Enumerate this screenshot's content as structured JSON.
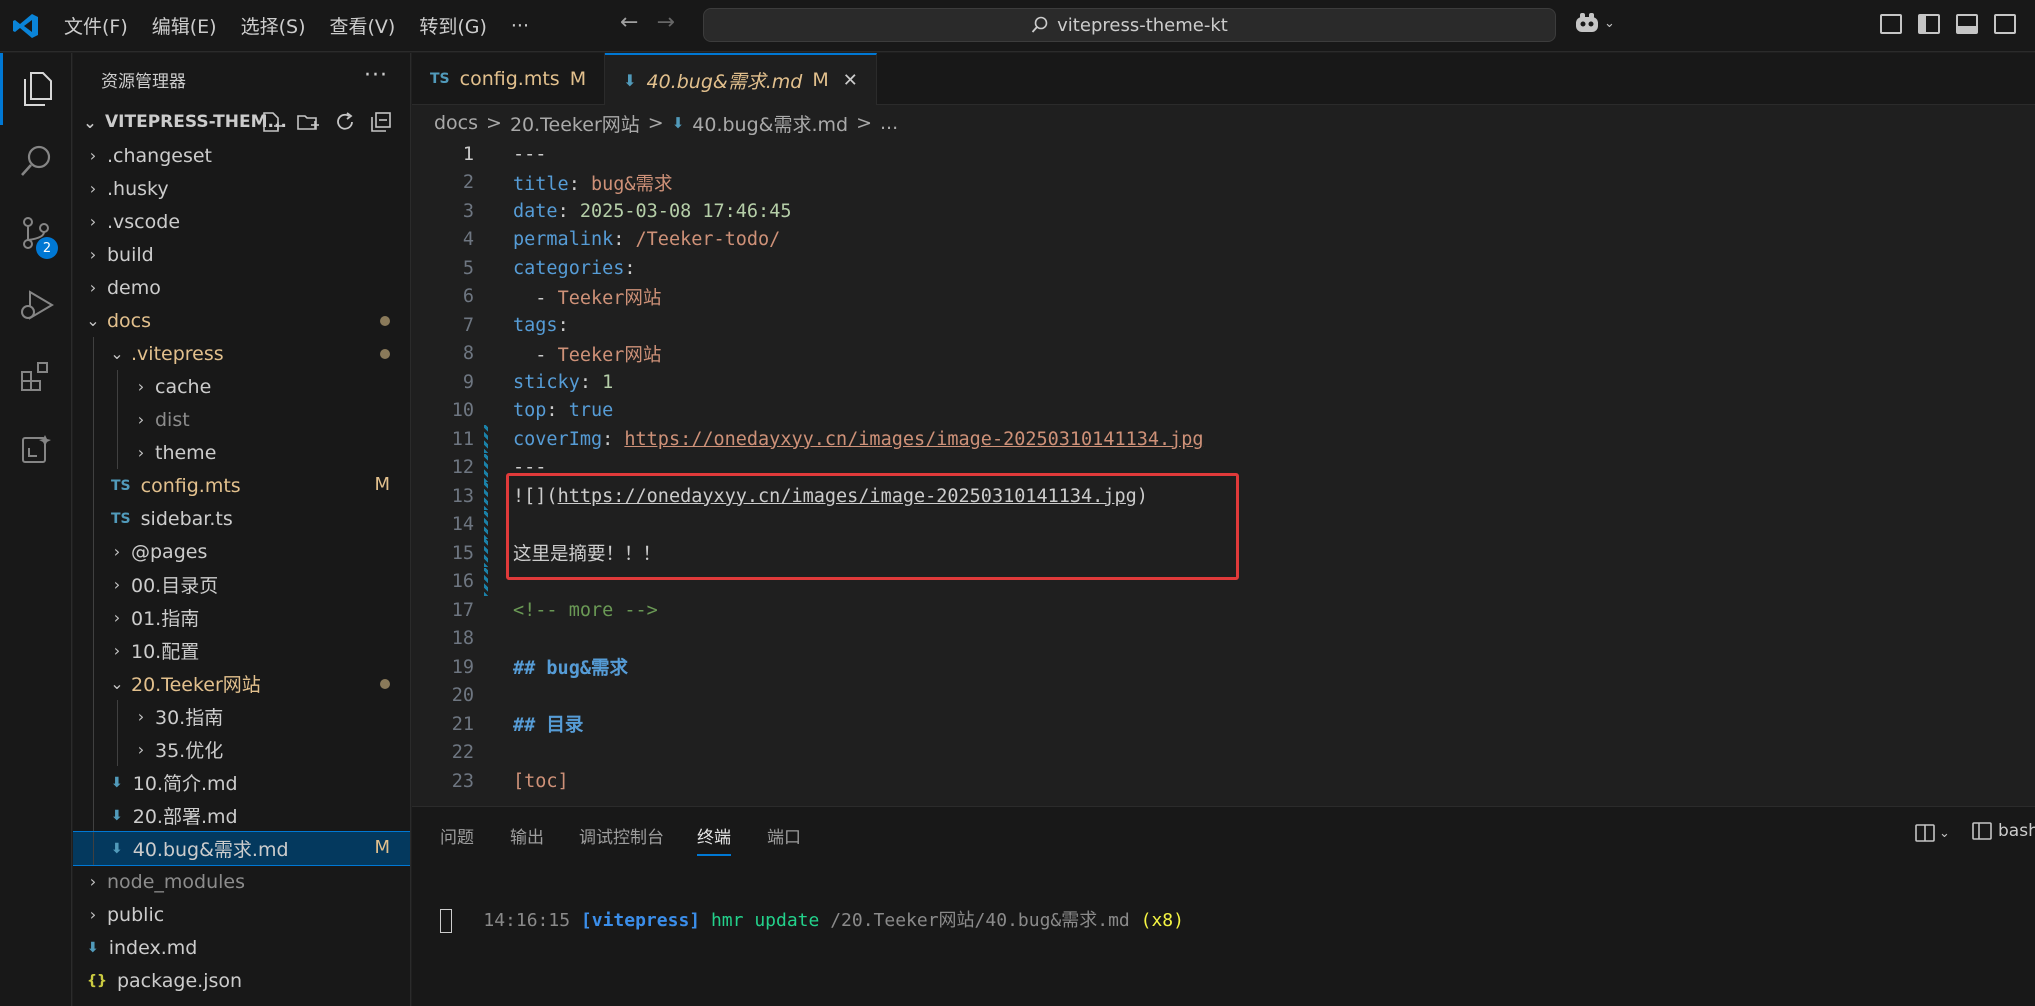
{
  "titlebar": {
    "menus": [
      "文件(F)",
      "编辑(E)",
      "选择(S)",
      "查看(V)",
      "转到(G)",
      "···"
    ],
    "search_text": "vitepress-theme-kt"
  },
  "activity": {
    "scm_badge": "2"
  },
  "sidebar": {
    "title": "资源管理器",
    "more": "···",
    "root": "VITEPRESS-THEM...",
    "items": [
      {
        "label": ".changeset",
        "indent": 0,
        "type": "folder",
        "open": false
      },
      {
        "label": ".husky",
        "indent": 0,
        "type": "folder",
        "open": false
      },
      {
        "label": ".vscode",
        "indent": 0,
        "type": "folder",
        "open": false
      },
      {
        "label": "build",
        "indent": 0,
        "type": "folder",
        "open": false
      },
      {
        "label": "demo",
        "indent": 0,
        "type": "folder",
        "open": false
      },
      {
        "label": "docs",
        "indent": 0,
        "type": "folder",
        "open": true,
        "dot": true,
        "color": "#e2c08d"
      },
      {
        "label": ".vitepress",
        "indent": 1,
        "type": "folder",
        "open": true,
        "dot": true,
        "color": "#e2c08d"
      },
      {
        "label": "cache",
        "indent": 2,
        "type": "folder",
        "open": false
      },
      {
        "label": "dist",
        "indent": 2,
        "type": "folder",
        "open": false,
        "color": "#8c8c8c"
      },
      {
        "label": "theme",
        "indent": 2,
        "type": "folder",
        "open": false
      },
      {
        "label": "config.mts",
        "indent": 1,
        "type": "ts",
        "mark": "M",
        "color": "#e2c08d"
      },
      {
        "label": "sidebar.ts",
        "indent": 1,
        "type": "ts"
      },
      {
        "label": "@pages",
        "indent": 1,
        "type": "folder",
        "open": false
      },
      {
        "label": "00.目录页",
        "indent": 1,
        "type": "folder",
        "open": false
      },
      {
        "label": "01.指南",
        "indent": 1,
        "type": "folder",
        "open": false
      },
      {
        "label": "10.配置",
        "indent": 1,
        "type": "folder",
        "open": false
      },
      {
        "label": "20.Teeker网站",
        "indent": 1,
        "type": "folder",
        "open": true,
        "dot": true,
        "color": "#e2c08d"
      },
      {
        "label": "30.指南",
        "indent": 2,
        "type": "folder",
        "open": false
      },
      {
        "label": "35.优化",
        "indent": 2,
        "type": "folder",
        "open": false
      },
      {
        "label": "10.简介.md",
        "indent": 1,
        "type": "md"
      },
      {
        "label": "20.部署.md",
        "indent": 1,
        "type": "md"
      },
      {
        "label": "40.bug&需求.md",
        "indent": 1,
        "type": "md",
        "mark": "M",
        "selected": true
      },
      {
        "label": "node_modules",
        "indent": 0,
        "type": "folder",
        "open": false,
        "color": "#8c8c8c"
      },
      {
        "label": "public",
        "indent": 0,
        "type": "folder",
        "open": false
      },
      {
        "label": "index.md",
        "indent": 0,
        "type": "md"
      },
      {
        "label": "package.json",
        "indent": 0,
        "type": "json"
      }
    ]
  },
  "tabs": [
    {
      "prefix": "TS",
      "label": "config.mts",
      "mark": "M",
      "active": false
    },
    {
      "prefix": "md",
      "label": "40.bug&需求.md",
      "mark": "M",
      "active": true,
      "close": "✕"
    }
  ],
  "breadcrumb": [
    "docs",
    ">",
    "20.Teeker网站",
    ">",
    "40.bug&需求.md",
    ">",
    "..."
  ],
  "editor": {
    "lines": [
      {
        "n": "1",
        "cur": true,
        "parts": [
          [
            "p",
            "---"
          ]
        ]
      },
      {
        "n": "2",
        "parts": [
          [
            "k",
            "title"
          ],
          [
            "p",
            ": "
          ],
          [
            "s",
            "bug&需求"
          ]
        ]
      },
      {
        "n": "3",
        "parts": [
          [
            "k",
            "date"
          ],
          [
            "p",
            ": "
          ],
          [
            "n",
            "2025-03-08 17:46:45"
          ]
        ]
      },
      {
        "n": "4",
        "parts": [
          [
            "k",
            "permalink"
          ],
          [
            "p",
            ": "
          ],
          [
            "s",
            "/Teeker-todo/"
          ]
        ]
      },
      {
        "n": "5",
        "parts": [
          [
            "k",
            "categories"
          ],
          [
            "p",
            ":"
          ]
        ]
      },
      {
        "n": "6",
        "parts": [
          [
            "p",
            "  - "
          ],
          [
            "s",
            "Teeker网站"
          ]
        ]
      },
      {
        "n": "7",
        "parts": [
          [
            "k",
            "tags"
          ],
          [
            "p",
            ":"
          ]
        ]
      },
      {
        "n": "8",
        "parts": [
          [
            "p",
            "  - "
          ],
          [
            "s",
            "Teeker网站"
          ]
        ]
      },
      {
        "n": "9",
        "parts": [
          [
            "k",
            "sticky"
          ],
          [
            "p",
            ": "
          ],
          [
            "n",
            "1"
          ]
        ]
      },
      {
        "n": "10",
        "parts": [
          [
            "k",
            "top"
          ],
          [
            "p",
            ": "
          ],
          [
            "k",
            "true"
          ]
        ]
      },
      {
        "n": "11",
        "mod": true,
        "parts": [
          [
            "k",
            "coverImg"
          ],
          [
            "p",
            ": "
          ],
          [
            "us",
            "https://onedayxyy.cn/images/image-20250310141134.jpg"
          ]
        ]
      },
      {
        "n": "12",
        "mod": true,
        "parts": [
          [
            "p",
            "---"
          ]
        ]
      },
      {
        "n": "13",
        "mod": true,
        "parts": [
          [
            "p",
            "![]("
          ],
          [
            "u",
            "https://onedayxyy.cn/images/image-20250310141134.jpg"
          ],
          [
            "p",
            ")"
          ]
        ]
      },
      {
        "n": "14",
        "mod": true,
        "parts": []
      },
      {
        "n": "15",
        "mod": true,
        "parts": [
          [
            "p",
            "这里是摘要！！！"
          ]
        ]
      },
      {
        "n": "16",
        "mod": true,
        "parts": []
      },
      {
        "n": "17",
        "parts": [
          [
            "cm",
            "<!-- more -->"
          ]
        ]
      },
      {
        "n": "18",
        "parts": []
      },
      {
        "n": "19",
        "parts": [
          [
            "h",
            "## bug&需求"
          ]
        ]
      },
      {
        "n": "20",
        "parts": []
      },
      {
        "n": "21",
        "parts": [
          [
            "h",
            "## 目录"
          ]
        ]
      },
      {
        "n": "22",
        "parts": []
      },
      {
        "n": "23",
        "parts": [
          [
            "br",
            "[toc]"
          ]
        ]
      }
    ]
  },
  "panel": {
    "tabs": [
      "问题",
      "输出",
      "调试控制台",
      "终端",
      "端口"
    ],
    "active_tab": "终端",
    "shell": "bash",
    "terminal": {
      "time": "14:16:15",
      "tag": "[vitepress]",
      "msg": "hmr update",
      "path": "/20.Teeker网站/40.bug&需求.md",
      "count": "(x8)"
    }
  }
}
